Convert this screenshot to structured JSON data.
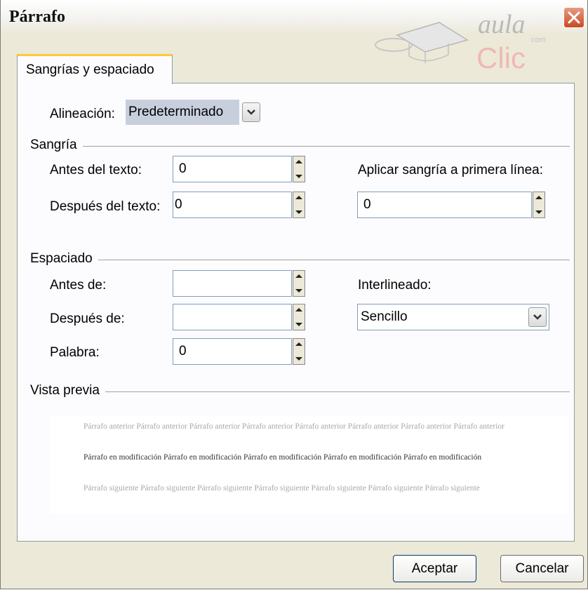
{
  "window": {
    "title": "Párrafo"
  },
  "logo": {
    "main": "aula",
    "sub": "Clic",
    "small": "com"
  },
  "tabs": [
    {
      "label": "Sangrías y espaciado"
    }
  ],
  "alignment": {
    "label": "Alineación:",
    "value": "Predeterminado"
  },
  "indent": {
    "group_label": "Sangría",
    "before_label": "Antes del texto:",
    "before_value": "0",
    "after_label": "Después del texto:",
    "after_value": "0",
    "first_line_label": "Aplicar sangría a primera línea:",
    "first_line_value": "0"
  },
  "spacing": {
    "group_label": "Espaciado",
    "before_label": "Antes de:",
    "before_value": "",
    "after_label": "Después de:",
    "after_value": "",
    "word_label": "Palabra:",
    "word_value": "0",
    "line_label": "Interlineado:",
    "line_value": "Sencillo"
  },
  "preview": {
    "group_label": "Vista previa",
    "previous": "Párrafo anterior Párrafo anterior Párrafo anterior Párrafo anterior Párrafo anterior Párrafo anterior Párrafo anterior Párrafo anterior",
    "current": "Párrafo en modificación Párrafo en modificación Párrafo en modificación Párrafo en modificación Párrafo en modificación",
    "next": "Párrafo siguiente Párrafo siguiente Párrafo siguiente Párrafo siguiente Párrafo siguiente Párrafo siguiente Párrafo siguiente"
  },
  "buttons": {
    "ok": "Aceptar",
    "cancel": "Cancelar"
  },
  "colors": {
    "tab_accent": "#ffc83c",
    "close": "#c94a25",
    "selection": "#c8cfdc"
  }
}
